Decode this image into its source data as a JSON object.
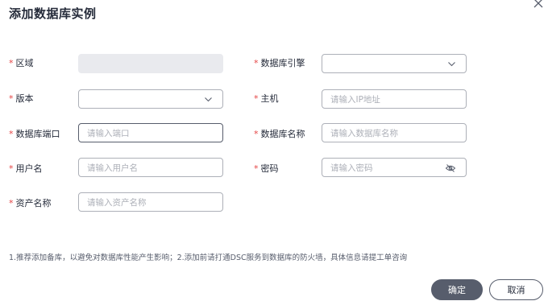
{
  "dialog": {
    "title": "添加数据库实例",
    "close_icon": "close-icon"
  },
  "form": {
    "region": {
      "label": "区域",
      "required": true,
      "value": ""
    },
    "db_engine": {
      "label": "数据库引擎",
      "required": true,
      "value": "",
      "icon": "chevron-down-icon"
    },
    "version": {
      "label": "版本",
      "required": true,
      "value": "",
      "icon": "chevron-down-icon"
    },
    "host": {
      "label": "主机",
      "required": true,
      "placeholder": "请输入IP地址"
    },
    "port": {
      "label": "数据库端口",
      "required": true,
      "placeholder": "请输入端口"
    },
    "db_name": {
      "label": "数据库名称",
      "required": true,
      "placeholder": "请输入数据库名称"
    },
    "username": {
      "label": "用户名",
      "required": true,
      "placeholder": "请输入用户名"
    },
    "password": {
      "label": "密码",
      "required": true,
      "placeholder": "请输入密码",
      "icon": "eye-off-icon"
    },
    "asset_name": {
      "label": "资产名称",
      "required": true,
      "placeholder": "请输入资产名称"
    }
  },
  "note": "1.推荐添加备库，以避免对数据库性能产生影响；2.添加前请打通DSC服务到数据库的防火墙，具体信息请提工单咨询",
  "buttons": {
    "confirm": "确定",
    "cancel": "取消"
  },
  "colors": {
    "required_star": "#e54545",
    "primary_button": "#575d6c",
    "border": "#adb0b8",
    "disabled_bg": "#e9eaee"
  }
}
